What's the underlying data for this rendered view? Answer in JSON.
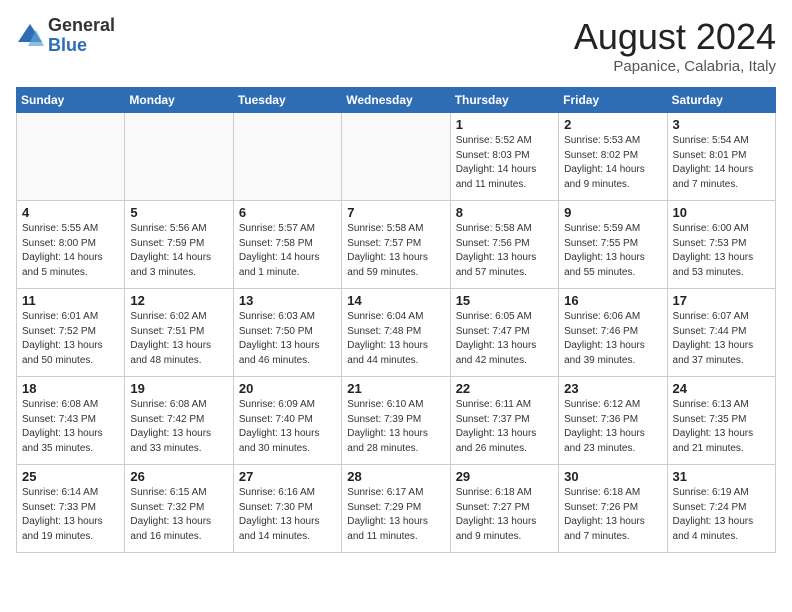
{
  "header": {
    "logo_general": "General",
    "logo_blue": "Blue",
    "month_title": "August 2024",
    "location": "Papanice, Calabria, Italy"
  },
  "days_of_week": [
    "Sunday",
    "Monday",
    "Tuesday",
    "Wednesday",
    "Thursday",
    "Friday",
    "Saturday"
  ],
  "weeks": [
    [
      {
        "num": "",
        "info": ""
      },
      {
        "num": "",
        "info": ""
      },
      {
        "num": "",
        "info": ""
      },
      {
        "num": "",
        "info": ""
      },
      {
        "num": "1",
        "info": "Sunrise: 5:52 AM\nSunset: 8:03 PM\nDaylight: 14 hours\nand 11 minutes."
      },
      {
        "num": "2",
        "info": "Sunrise: 5:53 AM\nSunset: 8:02 PM\nDaylight: 14 hours\nand 9 minutes."
      },
      {
        "num": "3",
        "info": "Sunrise: 5:54 AM\nSunset: 8:01 PM\nDaylight: 14 hours\nand 7 minutes."
      }
    ],
    [
      {
        "num": "4",
        "info": "Sunrise: 5:55 AM\nSunset: 8:00 PM\nDaylight: 14 hours\nand 5 minutes."
      },
      {
        "num": "5",
        "info": "Sunrise: 5:56 AM\nSunset: 7:59 PM\nDaylight: 14 hours\nand 3 minutes."
      },
      {
        "num": "6",
        "info": "Sunrise: 5:57 AM\nSunset: 7:58 PM\nDaylight: 14 hours\nand 1 minute."
      },
      {
        "num": "7",
        "info": "Sunrise: 5:58 AM\nSunset: 7:57 PM\nDaylight: 13 hours\nand 59 minutes."
      },
      {
        "num": "8",
        "info": "Sunrise: 5:58 AM\nSunset: 7:56 PM\nDaylight: 13 hours\nand 57 minutes."
      },
      {
        "num": "9",
        "info": "Sunrise: 5:59 AM\nSunset: 7:55 PM\nDaylight: 13 hours\nand 55 minutes."
      },
      {
        "num": "10",
        "info": "Sunrise: 6:00 AM\nSunset: 7:53 PM\nDaylight: 13 hours\nand 53 minutes."
      }
    ],
    [
      {
        "num": "11",
        "info": "Sunrise: 6:01 AM\nSunset: 7:52 PM\nDaylight: 13 hours\nand 50 minutes."
      },
      {
        "num": "12",
        "info": "Sunrise: 6:02 AM\nSunset: 7:51 PM\nDaylight: 13 hours\nand 48 minutes."
      },
      {
        "num": "13",
        "info": "Sunrise: 6:03 AM\nSunset: 7:50 PM\nDaylight: 13 hours\nand 46 minutes."
      },
      {
        "num": "14",
        "info": "Sunrise: 6:04 AM\nSunset: 7:48 PM\nDaylight: 13 hours\nand 44 minutes."
      },
      {
        "num": "15",
        "info": "Sunrise: 6:05 AM\nSunset: 7:47 PM\nDaylight: 13 hours\nand 42 minutes."
      },
      {
        "num": "16",
        "info": "Sunrise: 6:06 AM\nSunset: 7:46 PM\nDaylight: 13 hours\nand 39 minutes."
      },
      {
        "num": "17",
        "info": "Sunrise: 6:07 AM\nSunset: 7:44 PM\nDaylight: 13 hours\nand 37 minutes."
      }
    ],
    [
      {
        "num": "18",
        "info": "Sunrise: 6:08 AM\nSunset: 7:43 PM\nDaylight: 13 hours\nand 35 minutes."
      },
      {
        "num": "19",
        "info": "Sunrise: 6:08 AM\nSunset: 7:42 PM\nDaylight: 13 hours\nand 33 minutes."
      },
      {
        "num": "20",
        "info": "Sunrise: 6:09 AM\nSunset: 7:40 PM\nDaylight: 13 hours\nand 30 minutes."
      },
      {
        "num": "21",
        "info": "Sunrise: 6:10 AM\nSunset: 7:39 PM\nDaylight: 13 hours\nand 28 minutes."
      },
      {
        "num": "22",
        "info": "Sunrise: 6:11 AM\nSunset: 7:37 PM\nDaylight: 13 hours\nand 26 minutes."
      },
      {
        "num": "23",
        "info": "Sunrise: 6:12 AM\nSunset: 7:36 PM\nDaylight: 13 hours\nand 23 minutes."
      },
      {
        "num": "24",
        "info": "Sunrise: 6:13 AM\nSunset: 7:35 PM\nDaylight: 13 hours\nand 21 minutes."
      }
    ],
    [
      {
        "num": "25",
        "info": "Sunrise: 6:14 AM\nSunset: 7:33 PM\nDaylight: 13 hours\nand 19 minutes."
      },
      {
        "num": "26",
        "info": "Sunrise: 6:15 AM\nSunset: 7:32 PM\nDaylight: 13 hours\nand 16 minutes."
      },
      {
        "num": "27",
        "info": "Sunrise: 6:16 AM\nSunset: 7:30 PM\nDaylight: 13 hours\nand 14 minutes."
      },
      {
        "num": "28",
        "info": "Sunrise: 6:17 AM\nSunset: 7:29 PM\nDaylight: 13 hours\nand 11 minutes."
      },
      {
        "num": "29",
        "info": "Sunrise: 6:18 AM\nSunset: 7:27 PM\nDaylight: 13 hours\nand 9 minutes."
      },
      {
        "num": "30",
        "info": "Sunrise: 6:18 AM\nSunset: 7:26 PM\nDaylight: 13 hours\nand 7 minutes."
      },
      {
        "num": "31",
        "info": "Sunrise: 6:19 AM\nSunset: 7:24 PM\nDaylight: 13 hours\nand 4 minutes."
      }
    ]
  ]
}
